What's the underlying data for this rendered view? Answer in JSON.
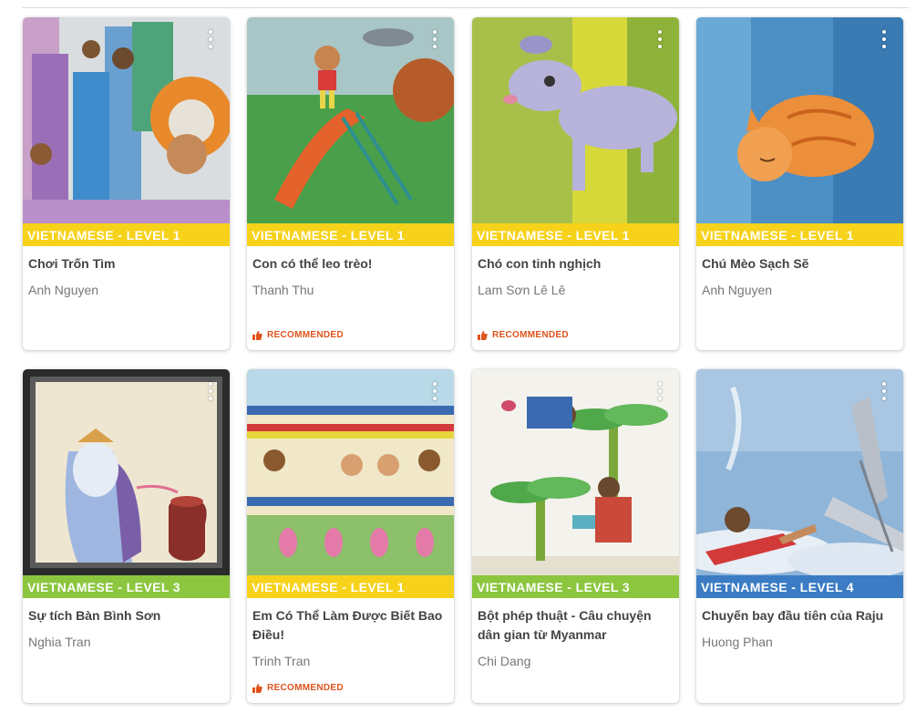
{
  "books": [
    {
      "level": "VIETNAMESE - LEVEL 1",
      "title": "Chơi Trốn Tìm",
      "author": "Anh Nguyen",
      "recommended": ""
    },
    {
      "level": "VIETNAMESE - LEVEL 1",
      "title": "Con có thể leo trèo!",
      "author": "Thanh Thu",
      "recommended": "RECOMMENDED"
    },
    {
      "level": "VIETNAMESE - LEVEL 1",
      "title": "Chó con tinh nghịch",
      "author": "Lam Sơn Lê Lê",
      "recommended": "RECOMMENDED"
    },
    {
      "level": "VIETNAMESE - LEVEL 1",
      "title": "Chú Mèo Sạch Sẽ",
      "author": "Anh Nguyen",
      "recommended": ""
    },
    {
      "level": "VIETNAMESE - LEVEL 3",
      "title": "Sự tích Bàn Bình Sơn",
      "author": "Nghia Tran",
      "recommended": ""
    },
    {
      "level": "VIETNAMESE - LEVEL 1",
      "title": "Em Có Thể Làm Được Biết Bao Điều!",
      "author": "Trinh Tran",
      "recommended": "RECOMMENDED"
    },
    {
      "level": "VIETNAMESE - LEVEL 3",
      "title": "Bột phép thuật - Câu chuyện dân gian từ Myanmar",
      "author": "Chi Dang",
      "recommended": ""
    },
    {
      "level": "VIETNAMESE - LEVEL 4",
      "title": "Chuyến bay đầu tiên của Raju",
      "author": "Huong Phan",
      "recommended": ""
    }
  ],
  "colors": {
    "level_1": "#f7d21a",
    "level_3": "#8cc63f",
    "level_4": "#3b7cc4",
    "recommended": "#e0531c"
  },
  "icons": {
    "card_menu": "more-vertical-icon",
    "recommended": "thumbs-up-icon"
  }
}
